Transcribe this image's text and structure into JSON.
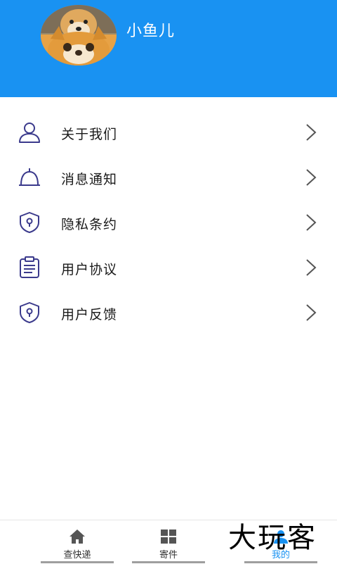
{
  "profile": {
    "username": "小鱼儿"
  },
  "menu": [
    {
      "label": "关于我们",
      "icon": "user-icon"
    },
    {
      "label": "消息通知",
      "icon": "bell-icon"
    },
    {
      "label": "隐私条约",
      "icon": "shield-icon"
    },
    {
      "label": "用户协议",
      "icon": "clipboard-icon"
    },
    {
      "label": "用户反馈",
      "icon": "shield-icon"
    }
  ],
  "tabs": [
    {
      "label": "查快递",
      "icon": "home-icon"
    },
    {
      "label": "寄件",
      "icon": "grid-icon"
    },
    {
      "label": "我的",
      "icon": "person-icon",
      "active": true
    }
  ],
  "watermark": "大玩客",
  "colors": {
    "accent": "#1992f2",
    "icon_stroke": "#3b3a8c"
  }
}
